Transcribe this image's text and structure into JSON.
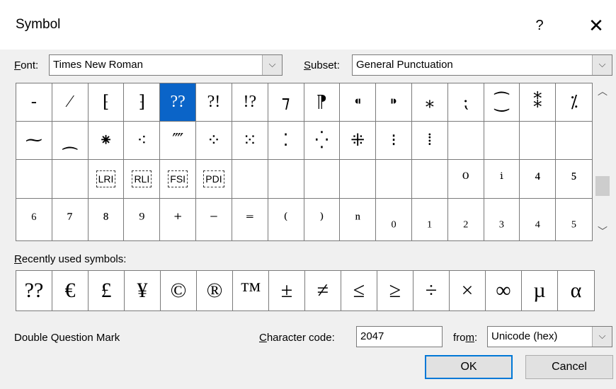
{
  "window": {
    "title": "Symbol",
    "help_label": "?",
    "close_label": "✕"
  },
  "font": {
    "label_pre": "",
    "label_key": "F",
    "label_post": "ont:",
    "value": "Times New Roman"
  },
  "subset": {
    "label_pre": "S",
    "label_key": "u",
    "label_post": "bset:",
    "value": "General Punctuation"
  },
  "grid": {
    "rows": [
      [
        "-",
        "⁄",
        "⁅",
        "⁆",
        "??",
        "?!",
        "!?",
        "⁊",
        "⁋",
        "⁌",
        "⁍",
        "⁎",
        "⁏",
        "⁐",
        "⁑",
        "⁒"
      ],
      [
        "⁓",
        "⁔",
        "⁕",
        "⁖",
        "⁗",
        "⁘",
        "⁙",
        "⁚",
        "⁛",
        "⁜",
        "⁝",
        "⁞",
        "",
        "",
        "",
        ""
      ],
      [
        "",
        "",
        "LRI",
        "RLI",
        "FSI",
        "PDI",
        "",
        "",
        "",
        "",
        "",
        "",
        "⁰",
        "ⁱ",
        "⁴",
        "⁵"
      ],
      [
        "⁶",
        "⁷",
        "⁸",
        "⁹",
        "⁺",
        "⁻",
        "⁼",
        "⁽",
        "⁾",
        "ⁿ",
        "₀",
        "₁",
        "₂",
        "₃",
        "₄",
        "₅"
      ]
    ],
    "selected_row": 0,
    "selected_col": 4
  },
  "recent": {
    "label_pre": "",
    "label_key": "R",
    "label_post": "ecently used symbols:",
    "symbols": [
      "??",
      "€",
      "£",
      "¥",
      "©",
      "®",
      "™",
      "±",
      "≠",
      "≤",
      "≥",
      "÷",
      "×",
      "∞",
      "µ",
      "α"
    ]
  },
  "char_name": "Double Question Mark",
  "char_code": {
    "label_pre": "",
    "label_key": "C",
    "label_post": "haracter code:",
    "value": "2047"
  },
  "from": {
    "label_pre": "fro",
    "label_key": "m",
    "label_post": ":",
    "value": "Unicode (hex)"
  },
  "buttons": {
    "ok": "OK",
    "cancel": "Cancel"
  }
}
